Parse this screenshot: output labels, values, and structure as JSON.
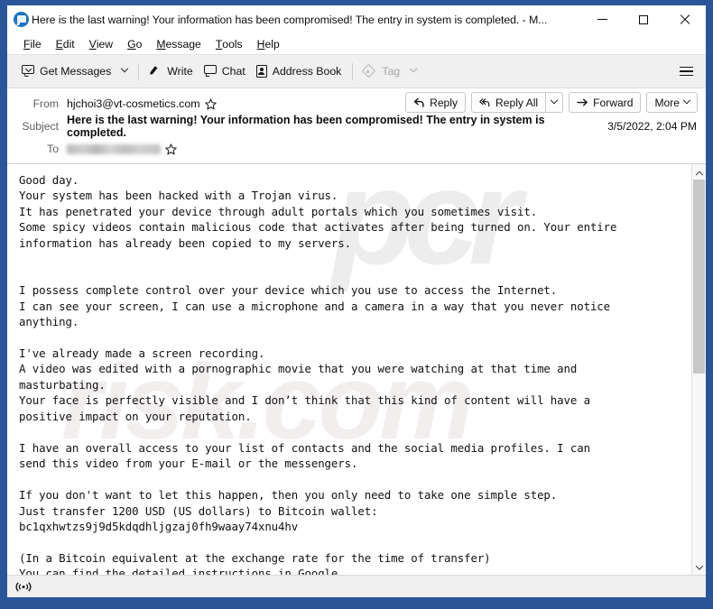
{
  "window": {
    "title": "Here is the last warning! Your information has been compromised! The entry in system is completed. - M...",
    "icon": "thunderbird-icon",
    "border_color": "#2a5699",
    "controls": {
      "minimize": "minimize-button",
      "maximize": "maximize-button",
      "close": "close-button"
    }
  },
  "menubar": {
    "items": [
      {
        "label": "File",
        "accel": "F"
      },
      {
        "label": "Edit",
        "accel": "E"
      },
      {
        "label": "View",
        "accel": "V"
      },
      {
        "label": "Go",
        "accel": "G"
      },
      {
        "label": "Message",
        "accel": "M"
      },
      {
        "label": "Tools",
        "accel": "T"
      },
      {
        "label": "Help",
        "accel": "H"
      }
    ]
  },
  "toolbar": {
    "get_messages": "Get Messages",
    "write": "Write",
    "chat": "Chat",
    "address_book": "Address Book",
    "tag": "Tag",
    "tag_disabled": true,
    "app_menu": "app-menu-button"
  },
  "header": {
    "from_label": "From",
    "from_value": "hjchoi3@vt-cosmetics.com",
    "subject_label": "Subject",
    "subject_value": "Here is the last warning! Your information has been compromised! The entry in system is completed.",
    "to_label": "To",
    "to_value": "",
    "to_redacted": true,
    "date": "3/5/2022, 2:04 PM",
    "actions": {
      "reply": "Reply",
      "reply_all": "Reply All",
      "forward": "Forward",
      "more": "More"
    }
  },
  "message": {
    "watermark_top": "pcr",
    "watermark_bottom": "risk.com",
    "body": "Good day.\nYour system has been hacked with a Trojan virus.\nIt has penetrated your device through adult portals which you sometimes visit.\nSome spicy videos contain malicious code that activates after being turned on. Your entire\ninformation has already been copied to my servers.\n\n\nI possess complete control over your device which you use to access the Internet.\nI can see your screen, I can use a microphone and a camera in a way that you never notice\nanything.\n\nI've already made a screen recording.\nA video was edited with a pornographic movie that you were watching at that time and\nmasturbating.\nYour face is perfectly visible and I don’t think that this kind of content will have a\npositive impact on your reputation.\n\nI have an overall access to your list of contacts and the social media profiles. I can\nsend this video from your E-mail or the messengers.\n\nIf you don't want to let this happen, then you only need to take one simple step.\nJust transfer 1200 USD (US dollars) to Bitcoin wallet:\nbc1qxhwtzs9j9d5kdqdhljgzaj0fh9waay74xnu4hv\n\n(In a Bitcoin equivalent at the exchange rate for the time of transfer)\nYou can find the detailed instructions in Google.",
    "ransom_amount": "1200 USD",
    "bitcoin_wallet": "bc1qxhwtzs9j9d5kdqdhljgzaj0fh9waay74xnu4hv"
  },
  "scrollbar": {
    "up": "scroll-up-arrow",
    "down": "scroll-down-arrow",
    "thumb_position": "top"
  },
  "statusbar": {
    "network_icon": "network-status-icon"
  }
}
